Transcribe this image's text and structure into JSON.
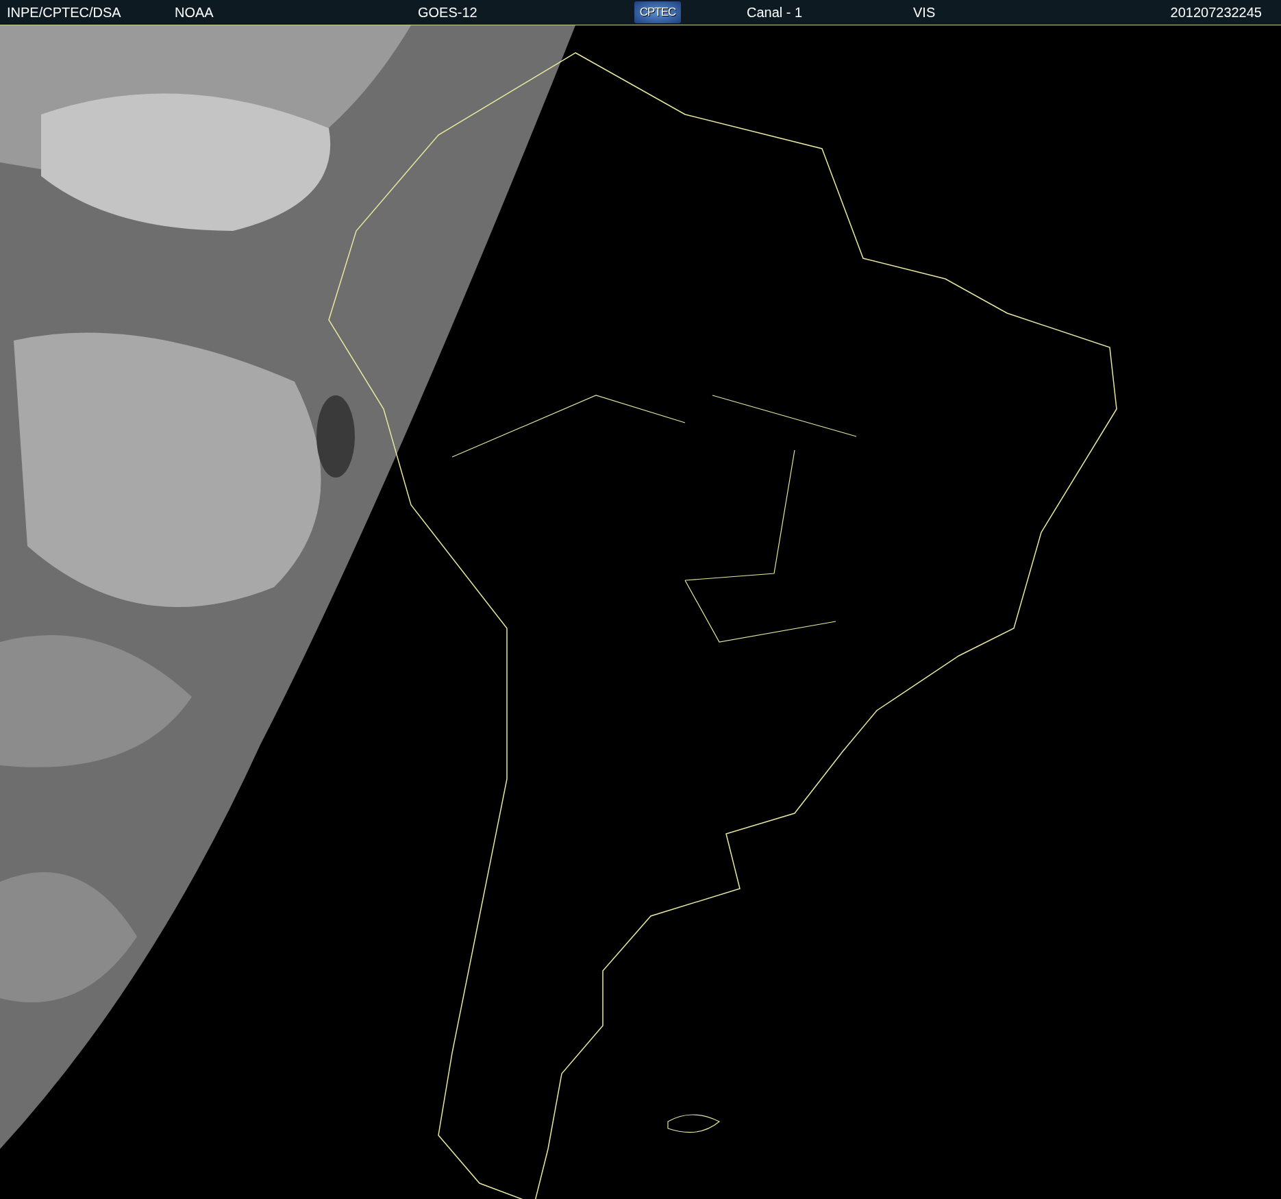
{
  "header": {
    "items": [
      {
        "kind": "text",
        "text": "INPE/CPTEC/DSA"
      },
      {
        "kind": "text",
        "text": "NOAA"
      },
      {
        "kind": "text",
        "text": "GOES-12"
      },
      {
        "kind": "logo",
        "text": "CPTEC"
      },
      {
        "kind": "text",
        "text": "Canal - 1"
      },
      {
        "kind": "text",
        "text": "VIS"
      },
      {
        "kind": "time",
        "text": "201207232245"
      }
    ]
  }
}
